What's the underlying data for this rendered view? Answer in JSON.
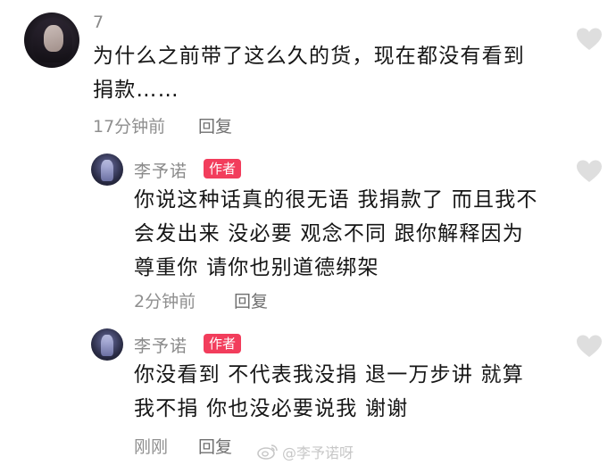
{
  "colors": {
    "author_badge_bg": "#f23d5c",
    "like_icon": "#dedede",
    "meta_text": "#8f8f8f"
  },
  "comment": {
    "username": "7",
    "text_line1": "为什么之前带了这么久的货，现在都没有看到",
    "text_line2": "捐款……",
    "time": "17分钟前",
    "reply_label": "回复",
    "like_icon": "heart-icon"
  },
  "replies": [
    {
      "username": "李予诺",
      "badge": "作者",
      "text_line1": "你说这种话真的很无语 我捐款了 而且我不",
      "text_line2": "会发出来 没必要 观念不同 跟你解释因为",
      "text_line3": "尊重你 请你也别道德绑架",
      "time": "2分钟前",
      "reply_label": "回复",
      "like_icon": "heart-icon"
    },
    {
      "username": "李予诺",
      "badge": "作者",
      "text_line1": "你没看到 不代表我没捐 退一万步讲 就算",
      "text_line2": "我不捐 你也没必要说我 谢谢",
      "time": "刚刚",
      "reply_label": "回复",
      "like_icon": "heart-icon"
    }
  ],
  "watermark": {
    "text": "@李予诺呀",
    "icon": "weibo-icon"
  }
}
